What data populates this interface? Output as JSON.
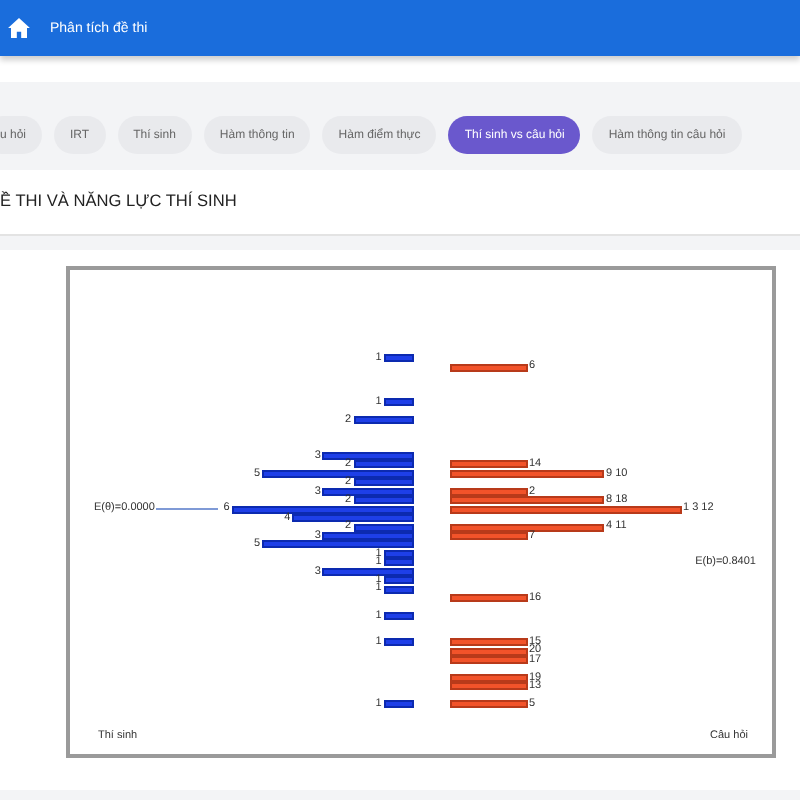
{
  "header": {
    "title": "Phân tích đề thi"
  },
  "tabs": [
    {
      "label": "u hỏi",
      "selected": false
    },
    {
      "label": "IRT",
      "selected": false
    },
    {
      "label": "Thí sinh",
      "selected": false
    },
    {
      "label": "Hàm thông tin",
      "selected": false
    },
    {
      "label": "Hàm điểm thực",
      "selected": false
    },
    {
      "label": "Thí sinh vs câu hỏi",
      "selected": true
    },
    {
      "label": "Hàm thông tin câu hỏi",
      "selected": false
    }
  ],
  "section_title": "Ề THI VÀ NĂNG LỰC THÍ SINH",
  "wright_map": {
    "person_axis_label": "Thí sinh",
    "item_axis_label": "Câu hỏi",
    "rows": [
      {
        "persons": "1"
      },
      {
        "items": "6"
      },
      {},
      {},
      {},
      {
        "persons": "1"
      },
      {},
      {
        "persons": "2"
      },
      {},
      {},
      {},
      {
        "persons": "3"
      },
      {
        "persons": "2",
        "items": "14"
      },
      {
        "persons": "5",
        "items": "9 10"
      },
      {
        "persons": "2"
      },
      {
        "persons": "3",
        "items": "2"
      },
      {
        "persons": "2",
        "items": "8 18"
      },
      {
        "persons": "6",
        "items": "1 3 12",
        "person_mean": "E(θ)=0.0000"
      },
      {
        "persons": "4"
      },
      {
        "persons": "2",
        "items": "4 11"
      },
      {
        "persons": "3",
        "items": "7"
      },
      {
        "persons": "5"
      },
      {
        "persons": "1"
      },
      {
        "persons": "1",
        "item_mean": "E(b)=0.8401"
      },
      {
        "persons": "3"
      },
      {
        "persons": "1"
      },
      {
        "persons": "1"
      },
      {
        "items": "16"
      },
      {},
      {
        "persons": "1"
      },
      {},
      {},
      {
        "persons": "1",
        "items": "15"
      },
      {
        "items": "20"
      },
      {
        "items": "17"
      },
      {},
      {
        "items": "19"
      },
      {
        "items": "13"
      },
      {},
      {
        "persons": "1",
        "items": "5"
      }
    ]
  }
}
